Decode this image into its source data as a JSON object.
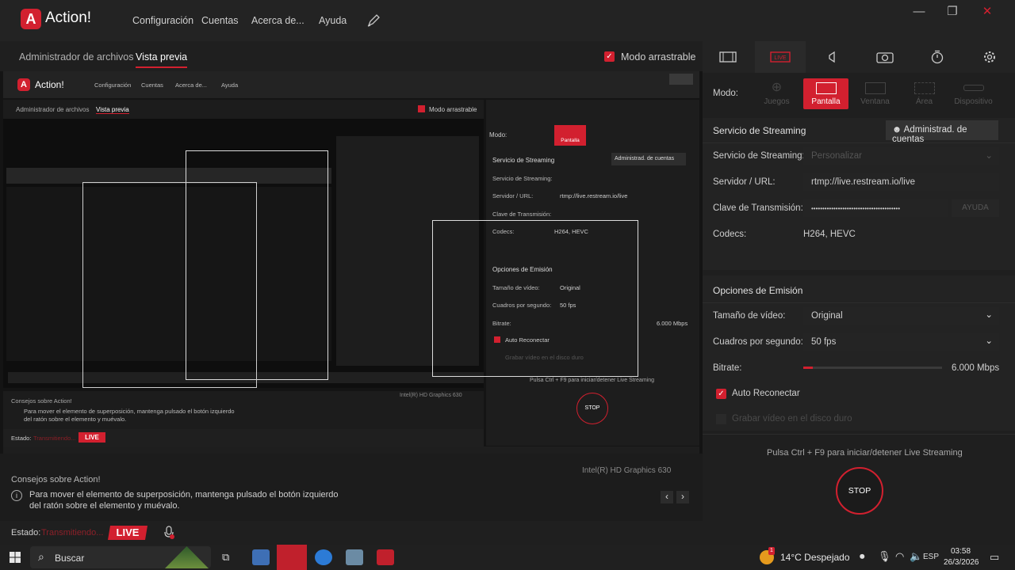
{
  "app": {
    "title": "Action!",
    "logo_glyph": "A"
  },
  "menu": {
    "items": [
      "Configuración",
      "Cuentas",
      "Acerca de...",
      "Ayuda"
    ],
    "pen_icon": "pen-icon"
  },
  "window": {
    "minimize": "—",
    "restore": "❐",
    "close": "✕"
  },
  "left": {
    "tabs": [
      "Administrador de archivos",
      "Vista previa"
    ],
    "drag_mode_label": "Modo arrastrable"
  },
  "tips": {
    "title": "Consejos sobre Action!",
    "text_line1": "Para mover el elemento de superposición, mantenga pulsado el botón izquierdo",
    "text_line2": "del ratón sobre el elemento y muévalo.",
    "gpu": "Intel(R) HD Graphics 630"
  },
  "status": {
    "label": "Estado:",
    "value": "Transmitiendo...",
    "live": "LIVE"
  },
  "right": {
    "mode_label": "Modo:",
    "modes": [
      "Juegos",
      "Pantalla",
      "Ventana",
      "Área",
      "Dispositivo"
    ],
    "streaming_title": "Servicio de Streaming",
    "manage_accounts": "Administrad. de cuentas",
    "service_label": "Servicio de Streaming:",
    "service_value": "Personalizar",
    "server_label": "Servidor / URL:",
    "server_value": "rtmp://live.restream.io/live",
    "key_label": "Clave de Transmisión:",
    "key_value": "••••••••••••••••••••••••••••••••••••••••",
    "help": "AYUDA",
    "codecs_label": "Codecs:",
    "codecs_value": "H264, HEVC",
    "emission_title": "Opciones de Emisión",
    "video_size_label": "Tamaño de vídeo:",
    "video_size_value": "Original",
    "fps_label": "Cuadros por segundo:",
    "fps_value": "50 fps",
    "bitrate_label": "Bitrate:",
    "bitrate_value": "6.000 Mbps",
    "bitrate_fraction": 0.07,
    "auto_reconnect": "Auto Reconectar",
    "record_disk": "Grabar vídeo en el disco duro",
    "hotkey_hint": "Pulsa Ctrl + F9 para iniciar/detener Live Streaming",
    "stop": "STOP"
  },
  "taskbar": {
    "search": "Buscar",
    "weather": "14°C  Despejado",
    "weather_badge": "1",
    "lang": "ESP",
    "time": "03:58",
    "date": "26/3/2026"
  },
  "colors": {
    "accent": "#d2202f",
    "bg": "#1c1c1c",
    "panel": "#232323"
  }
}
